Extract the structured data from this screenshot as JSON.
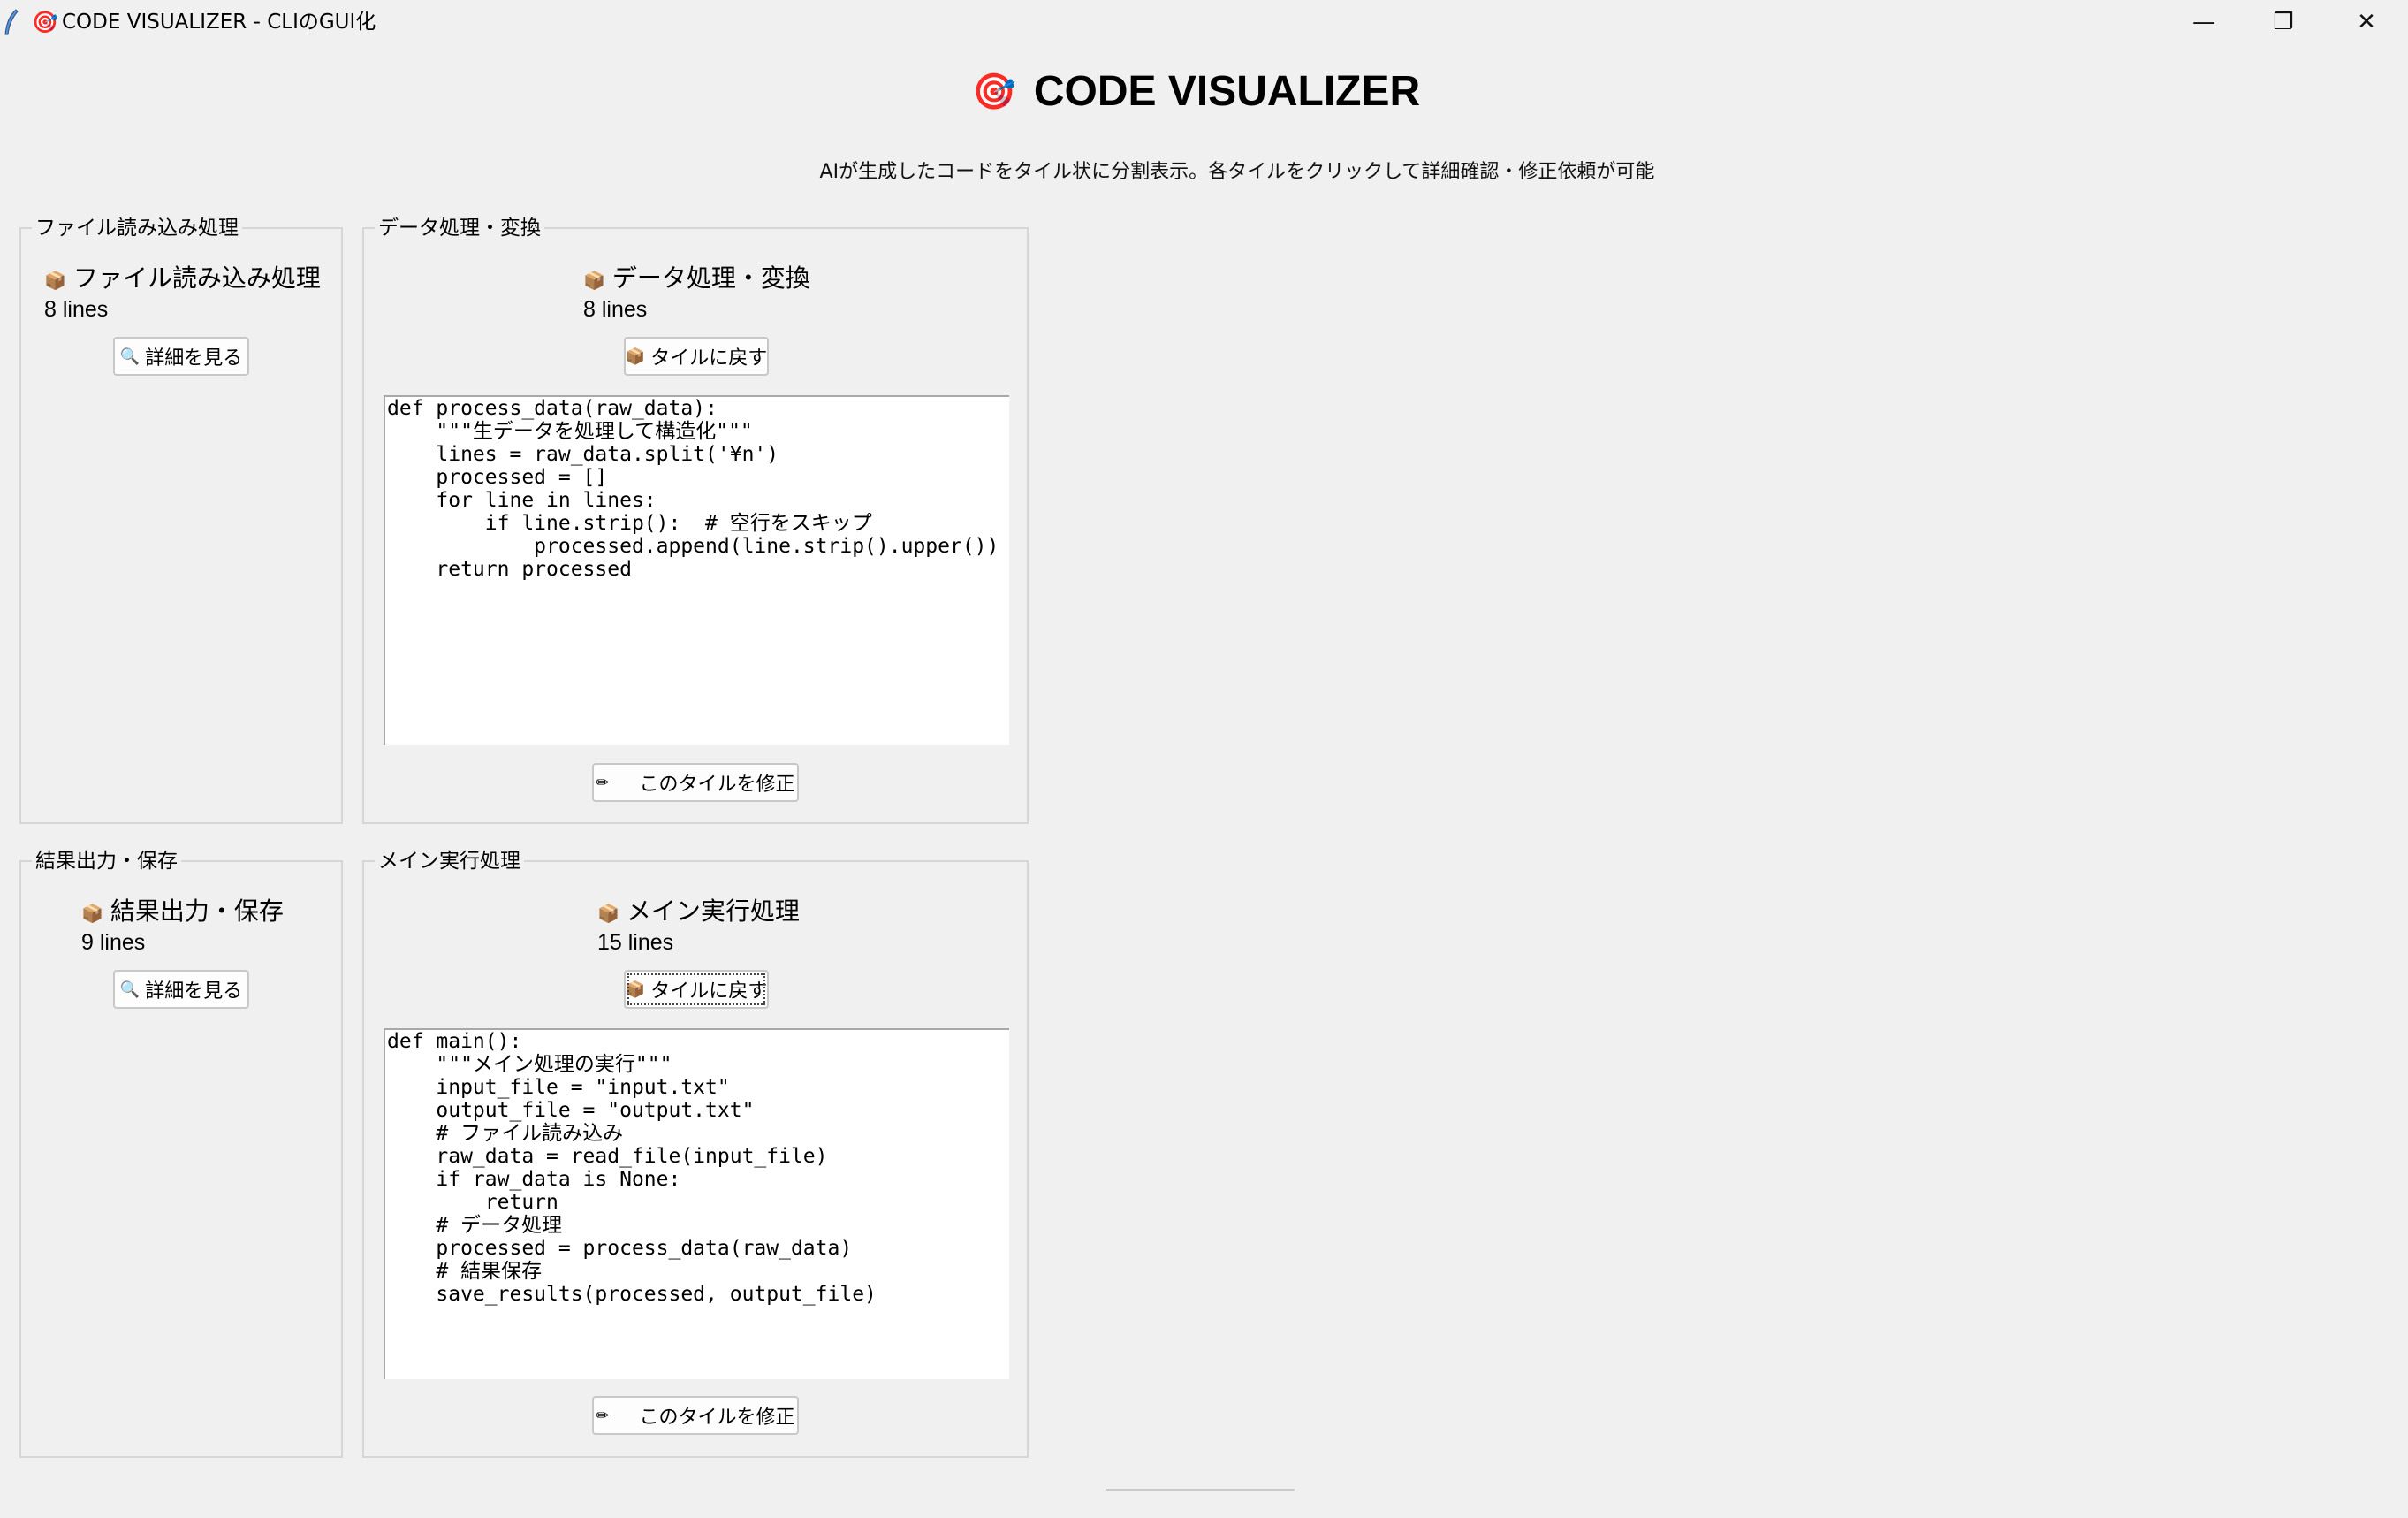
{
  "window": {
    "title": "CODE VISUALIZER - CLIのGUI化",
    "app_icon": "🎯",
    "controls": {
      "minimize": "—",
      "maximize": "❐",
      "close": "✕"
    }
  },
  "header": {
    "icon": "🎯",
    "title": "CODE VISUALIZER",
    "subtitle": "AIが生成したコードをタイル状に分割表示。各タイルをクリックして詳細確認・修正依頼が可能"
  },
  "icons": {
    "tile": "📦",
    "search": "🔍",
    "pencil": "✏"
  },
  "tiles": [
    {
      "group_label": "ファイル読み込み処理",
      "name": "ファイル読み込み処理",
      "lines": "8 lines",
      "button": "詳細を見る",
      "expanded": false
    },
    {
      "group_label": "データ処理・変換",
      "name": "データ処理・変換",
      "lines": "8 lines",
      "button": "タイルに戻す",
      "expanded": true,
      "code": [
        "def process_data(raw_data):",
        "    \"\"\"生データを処理して構造化\"\"\"",
        "    lines = raw_data.split('¥n')",
        "    processed = []",
        "    for line in lines:",
        "        if line.strip():  # 空行をスキップ",
        "            processed.append(line.strip().upper())",
        "    return processed"
      ],
      "edit_button": "このタイルを修正"
    },
    {
      "group_label": "結果出力・保存",
      "name": "結果出力・保存",
      "lines": "9 lines",
      "button": "詳細を見る",
      "expanded": false
    },
    {
      "group_label": "メイン実行処理",
      "name": "メイン実行処理",
      "lines": "15 lines",
      "button": "タイルに戻す",
      "expanded": true,
      "code": [
        "def main():",
        "    \"\"\"メイン処理の実行\"\"\"",
        "    input_file = \"input.txt\"",
        "    output_file = \"output.txt\"",
        "",
        "    # ファイル読み込み",
        "    raw_data = read_file(input_file)",
        "    if raw_data is None:",
        "        return",
        "",
        "    # データ処理",
        "    processed = process_data(raw_data)",
        "",
        "    # 結果保存",
        "    save_results(processed, output_file)"
      ],
      "edit_button": "このタイルを修正"
    }
  ]
}
